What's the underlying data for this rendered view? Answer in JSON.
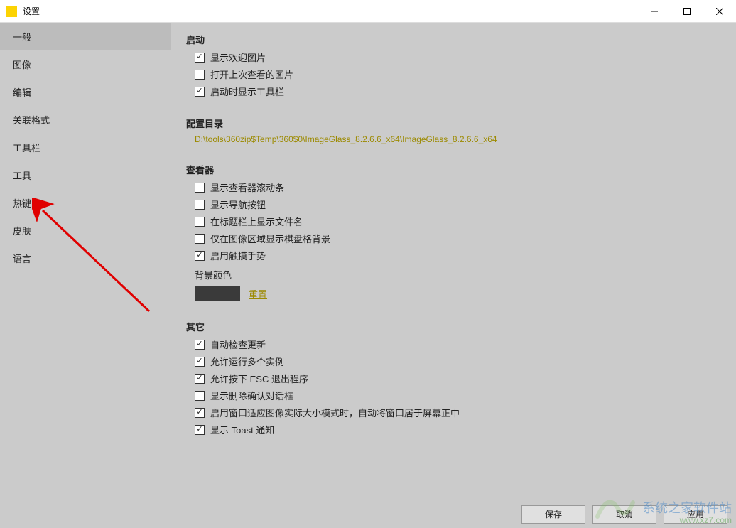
{
  "window": {
    "title": "设置",
    "icon_letter": "IG"
  },
  "sidebar": {
    "items": [
      {
        "label": "一般",
        "active": true
      },
      {
        "label": "图像",
        "active": false
      },
      {
        "label": "编辑",
        "active": false
      },
      {
        "label": "关联格式",
        "active": false
      },
      {
        "label": "工具栏",
        "active": false
      },
      {
        "label": "工具",
        "active": false
      },
      {
        "label": "热键",
        "active": false
      },
      {
        "label": "皮肤",
        "active": false
      },
      {
        "label": "语言",
        "active": false
      }
    ]
  },
  "sections": {
    "startup": {
      "title": "启动",
      "items": [
        {
          "label": "显示欢迎图片",
          "checked": true
        },
        {
          "label": "打开上次查看的图片",
          "checked": false
        },
        {
          "label": "启动时显示工具栏",
          "checked": true
        }
      ]
    },
    "configdir": {
      "title": "配置目录",
      "path": "D:\\tools\\360zip$Temp\\360$0\\ImageGlass_8.2.6.6_x64\\ImageGlass_8.2.6.6_x64"
    },
    "viewer": {
      "title": "查看器",
      "items": [
        {
          "label": "显示查看器滚动条",
          "checked": false
        },
        {
          "label": "显示导航按钮",
          "checked": false
        },
        {
          "label": "在标题栏上显示文件名",
          "checked": false
        },
        {
          "label": "仅在图像区域显示棋盘格背景",
          "checked": false
        },
        {
          "label": "启用触摸手势",
          "checked": true
        }
      ],
      "bg_label": "背景颜色",
      "bg_color": "#3a3a3a",
      "reset_label": "重置"
    },
    "others": {
      "title": "其它",
      "items": [
        {
          "label": "自动检查更新",
          "checked": true
        },
        {
          "label": "允许运行多个实例",
          "checked": true
        },
        {
          "label": "允许按下 ESC 退出程序",
          "checked": true
        },
        {
          "label": "显示删除确认对话框",
          "checked": false
        },
        {
          "label": "启用窗口适应图像实际大小模式时，自动将窗口居于屏幕正中",
          "checked": true
        },
        {
          "label": "显示 Toast 通知",
          "checked": true
        }
      ]
    }
  },
  "footer": {
    "save": "保存",
    "cancel": "取消",
    "apply": "应用"
  },
  "watermark": {
    "line1": "系统之家软件站",
    "line2": "www.xz7.com"
  }
}
